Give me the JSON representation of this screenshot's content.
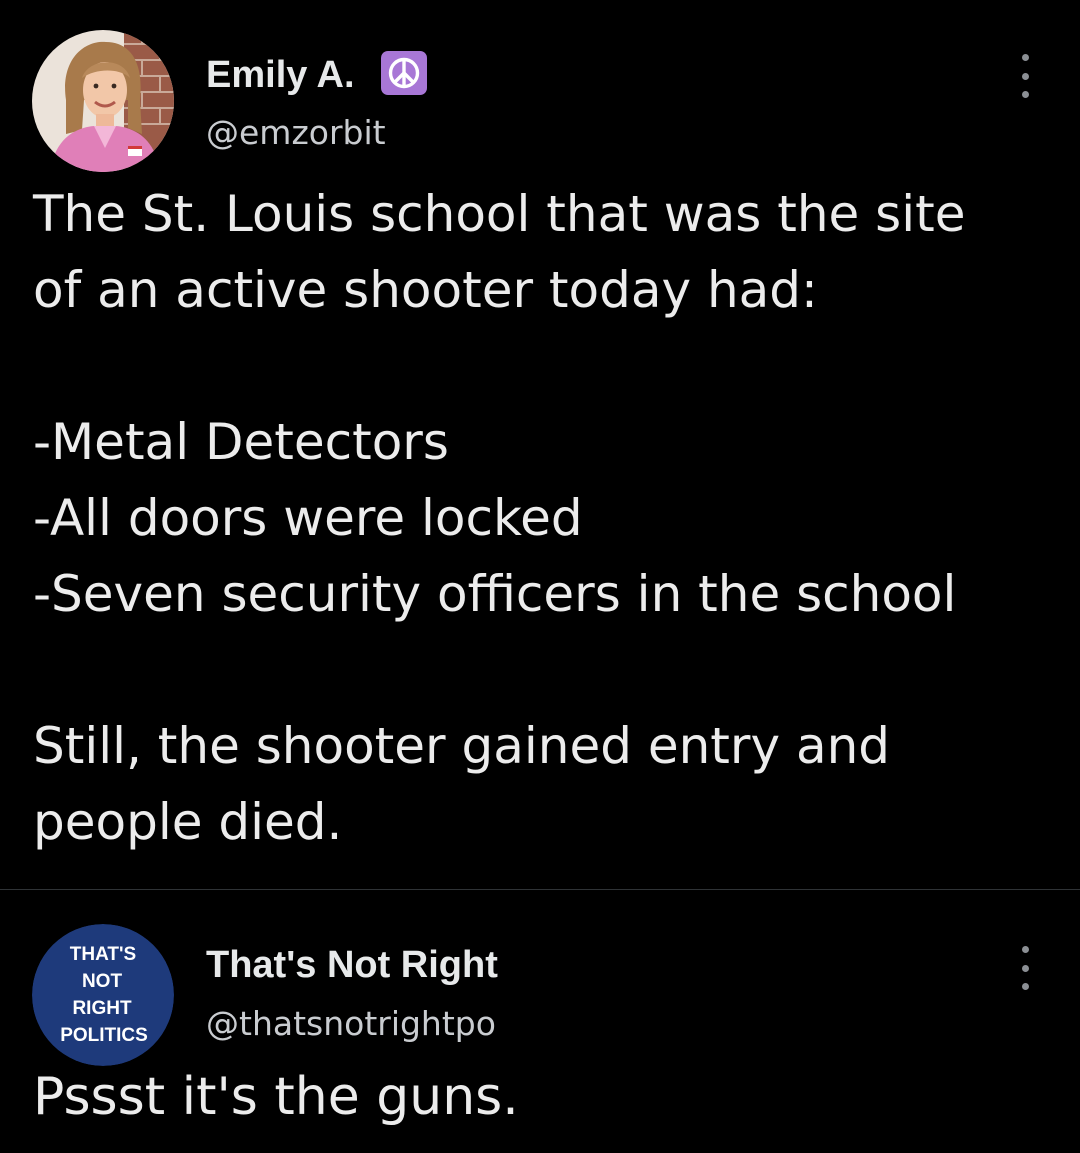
{
  "tweets": [
    {
      "display_name": "Emily A.",
      "badge_icon": "peace-sign-icon",
      "badge_color": "#a877d6",
      "handle": "@emzorbit",
      "lines": [
        "The St. Louis school that was the site",
        "of an active shooter today had:",
        "",
        "-Metal Detectors",
        "-All doors were locked",
        "-Seven security officers in the school",
        "",
        "Still, the shooter gained entry and",
        "people died."
      ]
    },
    {
      "display_name": "That's Not Right",
      "handle": "@thatsnotrightpo",
      "avatar_text": [
        "THAT'S",
        "NOT",
        "RIGHT",
        "POLITICS"
      ],
      "avatar_color": "#1e3a7b",
      "lines": [
        "Pssst it's the guns."
      ]
    }
  ],
  "colors": {
    "background": "#000000",
    "text": "#e7e9ea",
    "handle": "#c9ccd0",
    "divider": "#2f3336"
  }
}
